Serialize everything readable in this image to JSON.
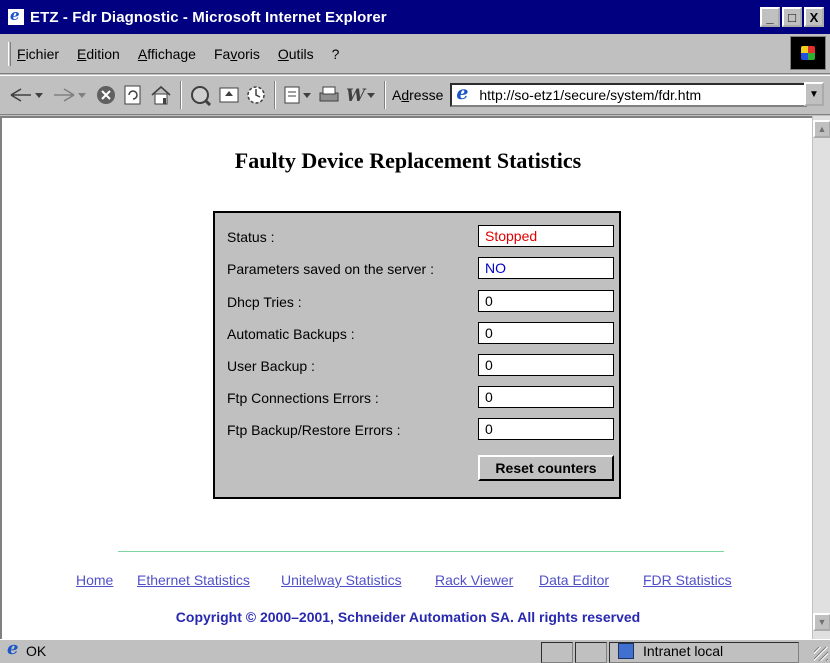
{
  "window": {
    "title": "ETZ - Fdr Diagnostic - Microsoft Internet Explorer",
    "minimize": "_",
    "maximize": "□",
    "close": "X"
  },
  "menu": {
    "items": [
      {
        "acc": "F",
        "rest": "ichier"
      },
      {
        "acc": "E",
        "rest": "dition"
      },
      {
        "acc": "A",
        "rest": "ffichage"
      },
      {
        "pre": "Fa",
        "acc": "v",
        "rest": "oris"
      },
      {
        "acc": "O",
        "rest": "utils"
      },
      {
        "acc": "",
        "rest": "?"
      }
    ]
  },
  "toolbar": {
    "address_label_pre": "A",
    "address_label_acc": "d",
    "address_label_rest": "resse",
    "url": "http://so-etz1/secure/system/fdr.htm"
  },
  "page": {
    "title": "Faulty Device Replacement Statistics",
    "fields": [
      {
        "label": "Status :",
        "value": "Stopped",
        "color": "#e00000"
      },
      {
        "label": "Parameters saved on the server :",
        "value": "NO",
        "color": "#0000c8"
      },
      {
        "label": "Dhcp Tries :",
        "value": "0",
        "color": "#000000"
      },
      {
        "label": "Automatic Backups :",
        "value": "0",
        "color": "#000000"
      },
      {
        "label": "User Backup :",
        "value": "0",
        "color": "#000000"
      },
      {
        "label": "Ftp Connections Errors :",
        "value": "0",
        "color": "#000000"
      },
      {
        "label": "Ftp Backup/Restore Errors :",
        "value": "0",
        "color": "#000000"
      }
    ],
    "reset_button": "Reset counters",
    "links": [
      "Home",
      "Ethernet Statistics",
      "Unitelway Statistics",
      "Rack Viewer",
      "Data Editor",
      "FDR Statistics"
    ],
    "copyright": "Copyright © 2000–2001, Schneider Automation SA. All rights reserved"
  },
  "status": {
    "text": "OK",
    "zone": "Intranet local"
  },
  "colors": {
    "title_bar": "#000080",
    "link": "#5050c8",
    "copyright": "#2828b0",
    "separator": "#7fd4a0"
  }
}
